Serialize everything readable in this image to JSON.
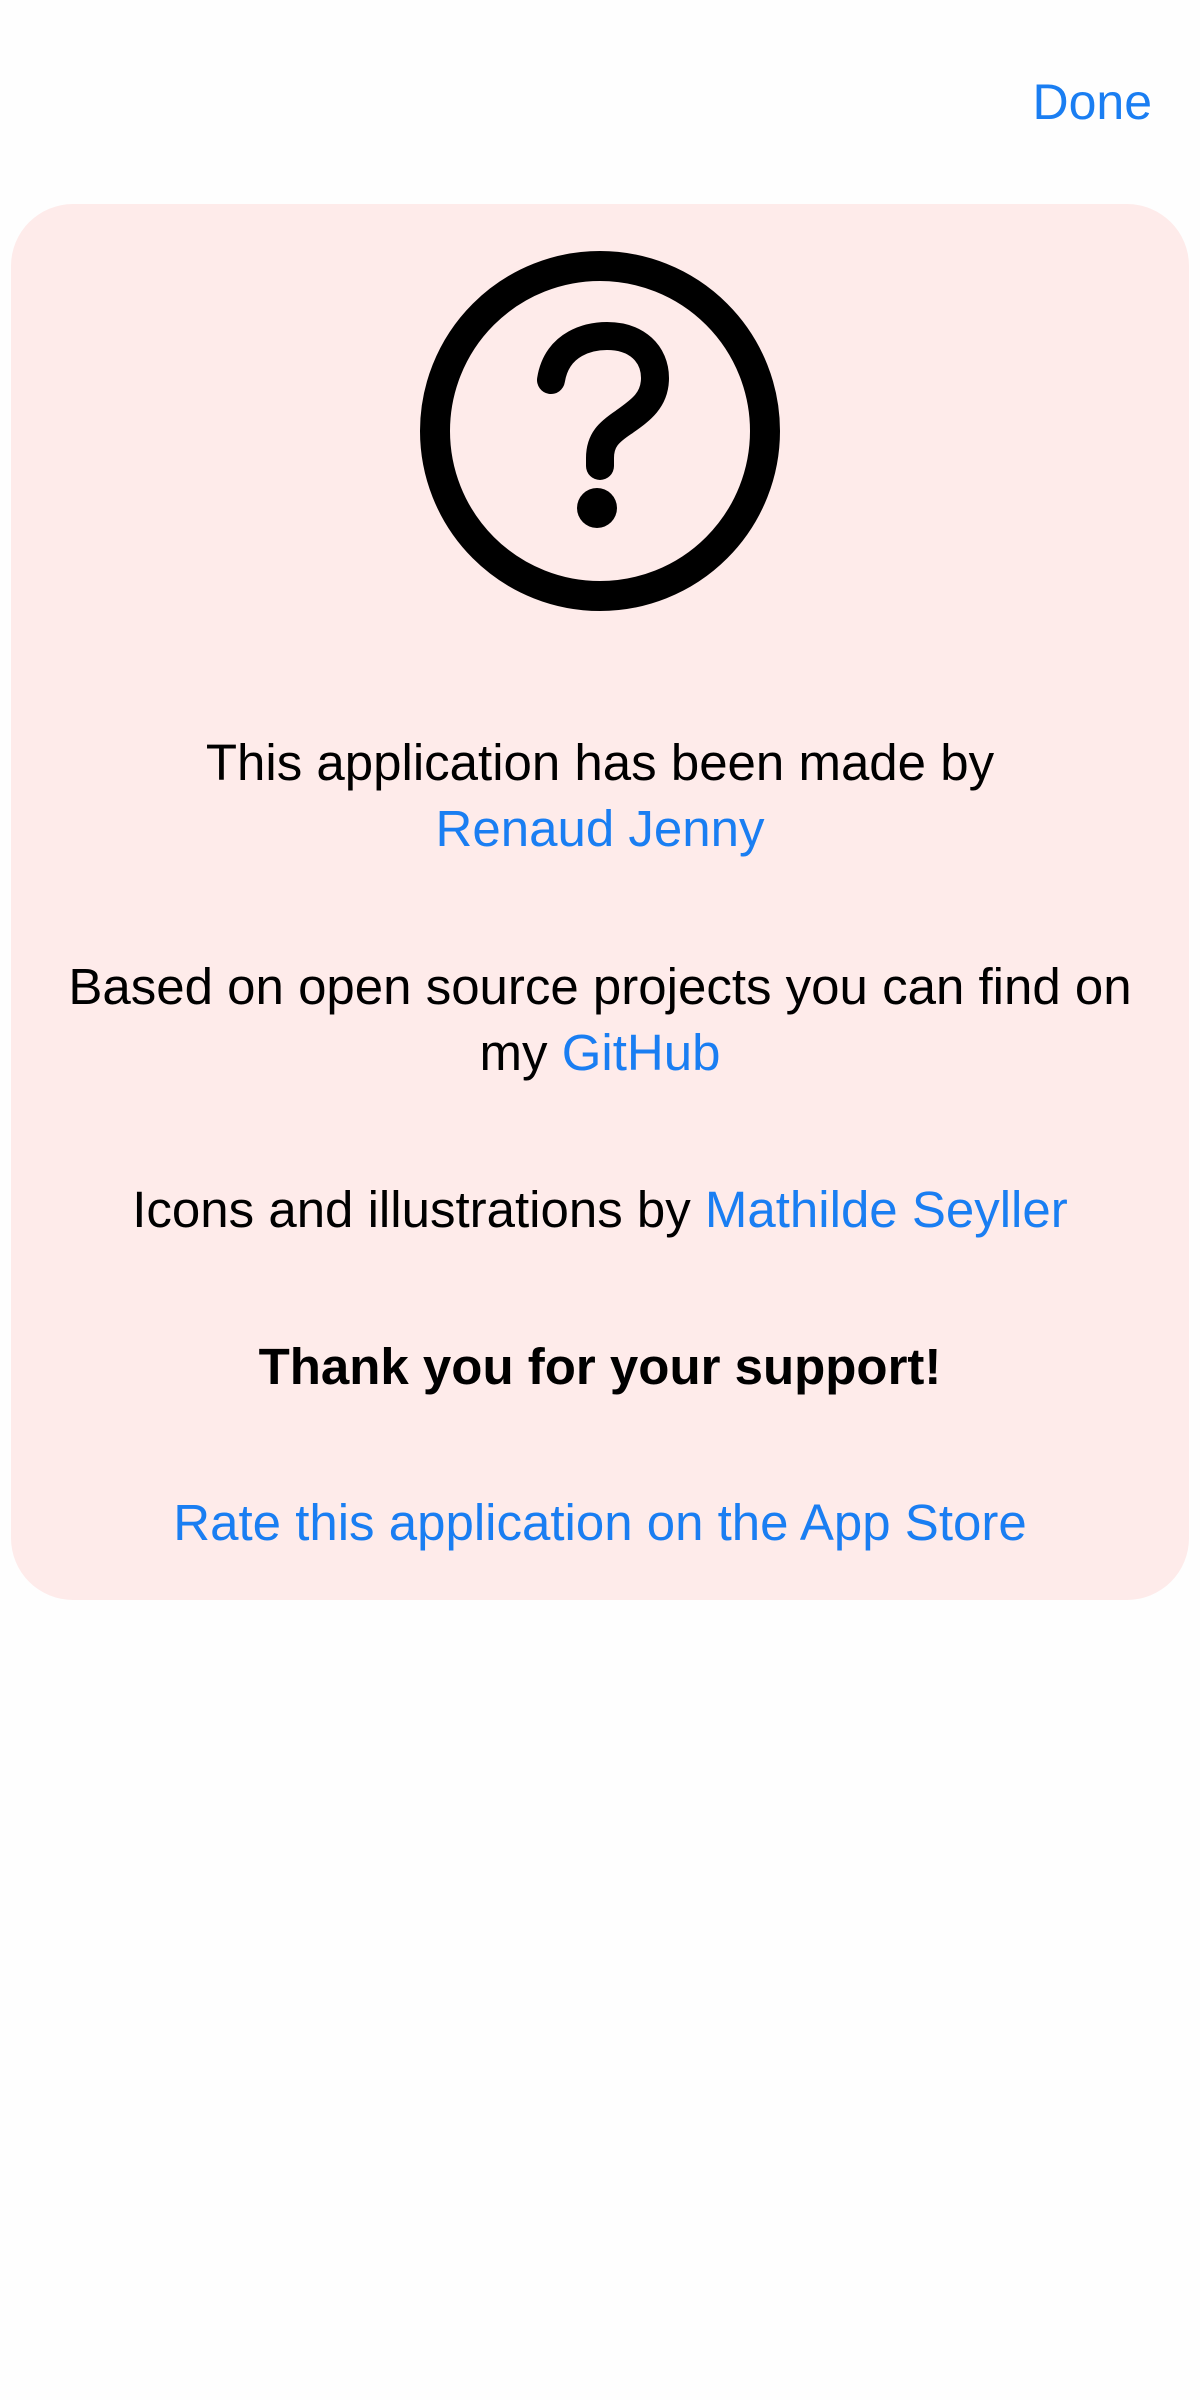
{
  "nav": {
    "done_label": "Done"
  },
  "card": {
    "icon": "question-circle-icon",
    "made_by_text": "This application has been made by",
    "author_name": "Renaud Jenny",
    "based_on_text_line1": "Based on open source projects you can find on",
    "based_on_text_line2": "my",
    "github_label": "GitHub",
    "icons_text": "Icons and illustrations by",
    "illustrator_name": "Mathilde Seyller",
    "thanks_text": "Thank you for your support!",
    "rate_label": "Rate this application on the App Store"
  },
  "colors": {
    "accent": "#1a7ef2",
    "card_background": "#feebea",
    "page_background": "#fefefe",
    "text": "#000000"
  }
}
